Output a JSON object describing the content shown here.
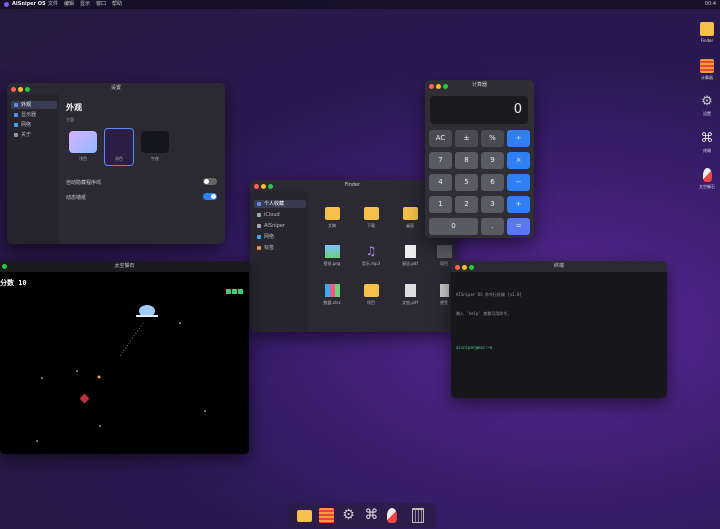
{
  "menubar": {
    "brand": "AISniper OS",
    "items": [
      "文件",
      "编辑",
      "显示",
      "窗口",
      "帮助"
    ],
    "time": "00:4"
  },
  "settings": {
    "title": "设置",
    "sidebar": [
      "外观",
      "显示器",
      "网络",
      "关于"
    ],
    "heading": "外观",
    "theme_label": "主题",
    "themes": [
      "浅色",
      "深色",
      "午夜"
    ],
    "auto_hide_dock": "自动隐藏程序坞",
    "dynamic_wallpaper": "动态墙纸"
  },
  "calculator": {
    "title": "计算器",
    "display": "0",
    "keys": [
      "AC",
      "±",
      "%",
      "÷",
      "7",
      "8",
      "9",
      "×",
      "4",
      "5",
      "6",
      "−",
      "1",
      "2",
      "3",
      "+",
      "0",
      ".",
      "="
    ]
  },
  "finder": {
    "title": "Finder",
    "sidebar": [
      "个人收藏",
      "iCloud",
      "AISniper",
      "网络",
      "标签"
    ],
    "items": [
      "文稿",
      "下载",
      "桌面",
      "壁纸.png",
      "音乐.mp3",
      "报告.pdf",
      "项目",
      "数据.xlsx",
      "项目",
      "文档.pdf",
      "便签"
    ]
  },
  "game": {
    "title": "太空躲石",
    "score_label": "分数",
    "score": "10"
  },
  "terminal": {
    "title": "终端",
    "line1": "AISniper OS 命令行终端 [v1.0]",
    "line2": "输入 'help' 查看可用命令。",
    "prompt": "aisniper@mac:~$"
  },
  "desktop": [
    "Finder",
    "计算器",
    "设置",
    "终端",
    "太空躲石"
  ],
  "dock": [
    "finder",
    "calculator",
    "settings",
    "terminal",
    "rocket",
    "trash"
  ]
}
